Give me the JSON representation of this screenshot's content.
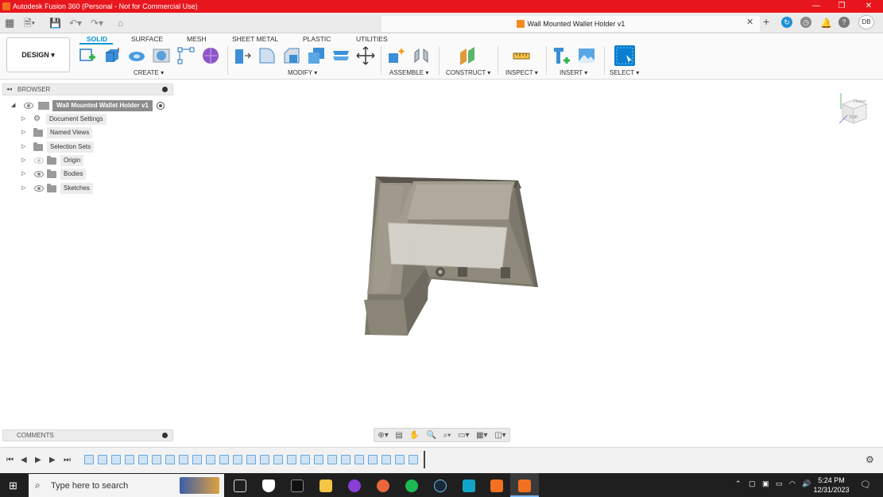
{
  "window": {
    "title": "Autodesk Fusion 360 (Personal - Not for Commercial Use)",
    "minimize_icon": "minimize-icon",
    "restore_icon": "restore-icon",
    "close_icon": "close-icon"
  },
  "document": {
    "tab_title": "Wall Mounted Wallet Holder v1",
    "user_initials": "DB"
  },
  "toolbar": {
    "workspace": "DESIGN ▾",
    "tabs": [
      "SOLID",
      "SURFACE",
      "MESH",
      "SHEET METAL",
      "PLASTIC",
      "UTILITIES"
    ],
    "active_tab": "SOLID",
    "groups": [
      "CREATE ▾",
      "MODIFY ▾",
      "ASSEMBLE ▾",
      "CONSTRUCT ▾",
      "INSPECT ▾",
      "INSERT ▾",
      "SELECT ▾"
    ]
  },
  "browser": {
    "header": "BROWSER",
    "root": "Wall Mounted Wallet Holder v1",
    "items": [
      "Document Settings",
      "Named Views",
      "Selection Sets",
      "Origin",
      "Bodies",
      "Sketches"
    ]
  },
  "viewcube": {
    "face": "TOP",
    "side": "FRONT"
  },
  "comments": {
    "header": "COMMENTS"
  },
  "taskbar": {
    "search_placeholder": "Type here to search",
    "time": "5:24 PM",
    "date": "12/31/2023"
  },
  "colors": {
    "titlebar": "#e8161d",
    "accent": "#0696d7",
    "model": "#8f8a7d"
  }
}
